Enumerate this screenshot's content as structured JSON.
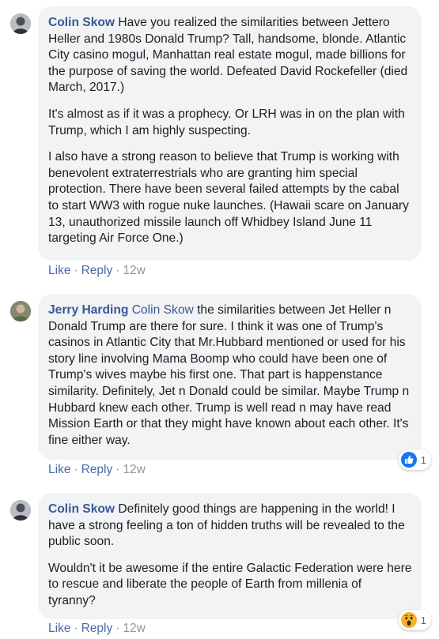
{
  "comments": [
    {
      "author": "Colin Skow",
      "tag": "",
      "paragraphs": [
        "Have you realized the similarities between Jettero Heller and 1980s Donald Trump? Tall, handsome, blonde. Atlantic City casino mogul, Manhattan real estate mogul, made billions for the purpose of saving the world. Defeated David Rockefeller (died March, 2017.)",
        "It's almost as if it was a prophecy. Or LRH was in on the plan with Trump, which I am highly suspecting.",
        "I also have a strong reason to believe that Trump is working with benevolent extraterrestrials who are granting him special protection. There have been several failed attempts by the cabal to start WW3 with rogue nuke launches. (Hawaii scare on January 13, unauthorized missile launch off Whidbey Island June 11 targeting Air Force One.)"
      ],
      "like_label": "Like",
      "reply_label": "Reply",
      "time": "12w",
      "reaction": null
    },
    {
      "author": "Jerry Harding",
      "tag": "Colin Skow",
      "paragraphs": [
        "the similarities between Jet Heller n Donald Trump are there for sure. I think it was one of Trump's casinos in Atlantic City that Mr.Hubbard mentioned or used for his story line involving Mama Boomp who could have been one of Trump's wives maybe his first one. That part is happenstance similarity. Definitely, Jet n Donald could be similar. Maybe Trump n Hubbard knew each other. Trump is well read n may have read Mission Earth or that they might have known about each other. It's fine either way."
      ],
      "like_label": "Like",
      "reply_label": "Reply",
      "time": "12w",
      "reaction": {
        "icon": "like-icon",
        "count": "1",
        "color": "#1877f2"
      }
    },
    {
      "author": "Colin Skow",
      "tag": "",
      "paragraphs": [
        "Definitely good things are happening in the world! I have a strong feeling a ton of hidden truths will be revealed to the public soon.",
        "Wouldn't it be awesome if the entire Galactic Federation were here to rescue and liberate the people of Earth from millenia of tyranny?"
      ],
      "like_label": "Like",
      "reply_label": "Reply",
      "time": "12w",
      "reaction": {
        "icon": "wow-icon",
        "count": "1",
        "color": "#f7b125"
      }
    }
  ]
}
